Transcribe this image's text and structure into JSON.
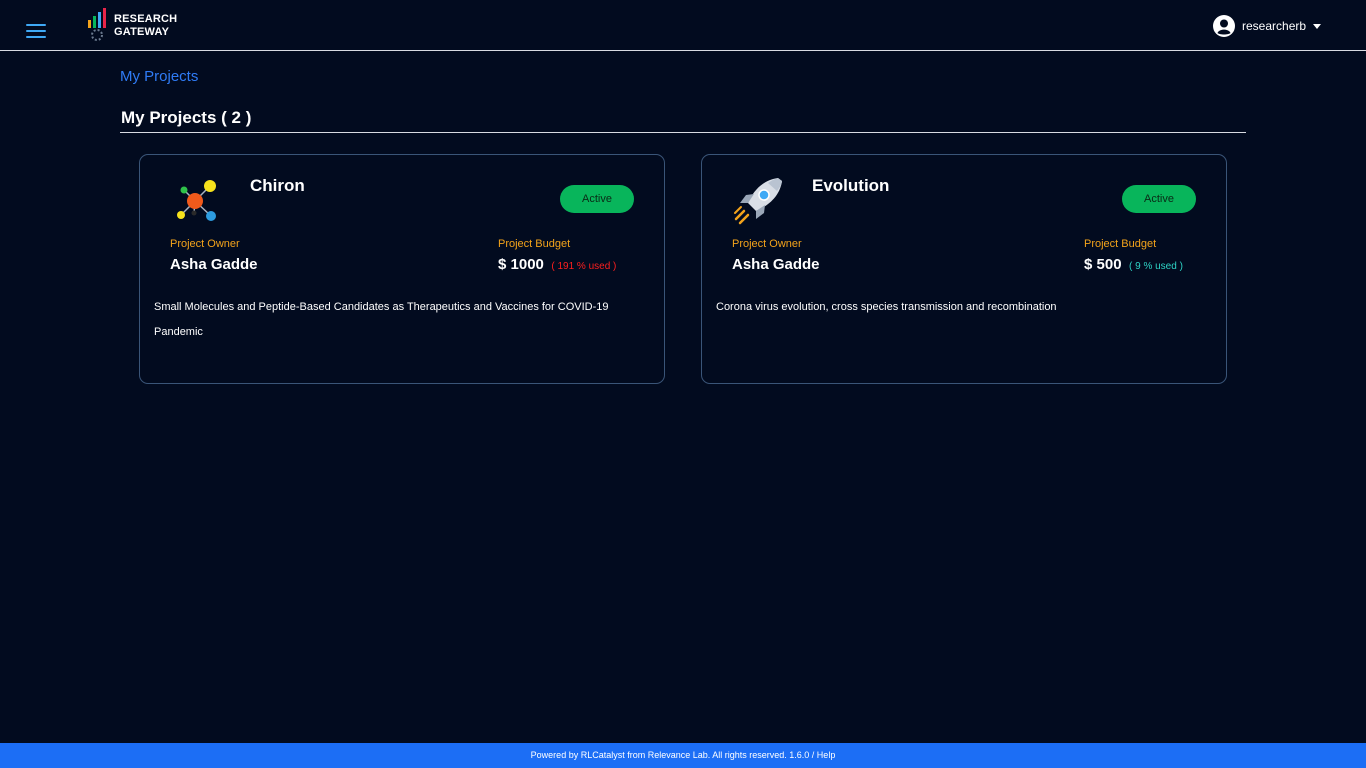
{
  "header": {
    "logo_line1": "RESEARCH",
    "logo_line2": "GATEWAY",
    "username": "researcherb"
  },
  "breadcrumb": "My Projects",
  "section_title": "My Projects ( 2 )",
  "projects": [
    {
      "name": "Chiron",
      "icon": "molecule-icon",
      "status": "Active",
      "owner_label": "Project Owner",
      "owner": "Asha Gadde",
      "budget_label": "Project Budget",
      "budget": "$ 1000",
      "used": "( 191 % used )",
      "used_color": "#ff1f1f",
      "description": "Small Molecules and Peptide-Based Candidates as Therapeutics and Vaccines for COVID-19 Pandemic"
    },
    {
      "name": "Evolution",
      "icon": "rocket-icon",
      "status": "Active",
      "owner_label": "Project Owner",
      "owner": "Asha Gadde",
      "budget_label": "Project Budget",
      "budget": "$ 500",
      "used": "( 9 % used )",
      "used_color": "#2ed3c6",
      "description": "Corona virus evolution, cross species transmission and recombination"
    }
  ],
  "footer": {
    "text": "Powered by RLCatalyst from Relevance Lab. All rights reserved. 1.6.0 / Help"
  },
  "colors": {
    "background": "#020b1f",
    "accent": "#1c6ef5",
    "status_active": "#08b55b",
    "label_orange": "#f3a31b"
  }
}
